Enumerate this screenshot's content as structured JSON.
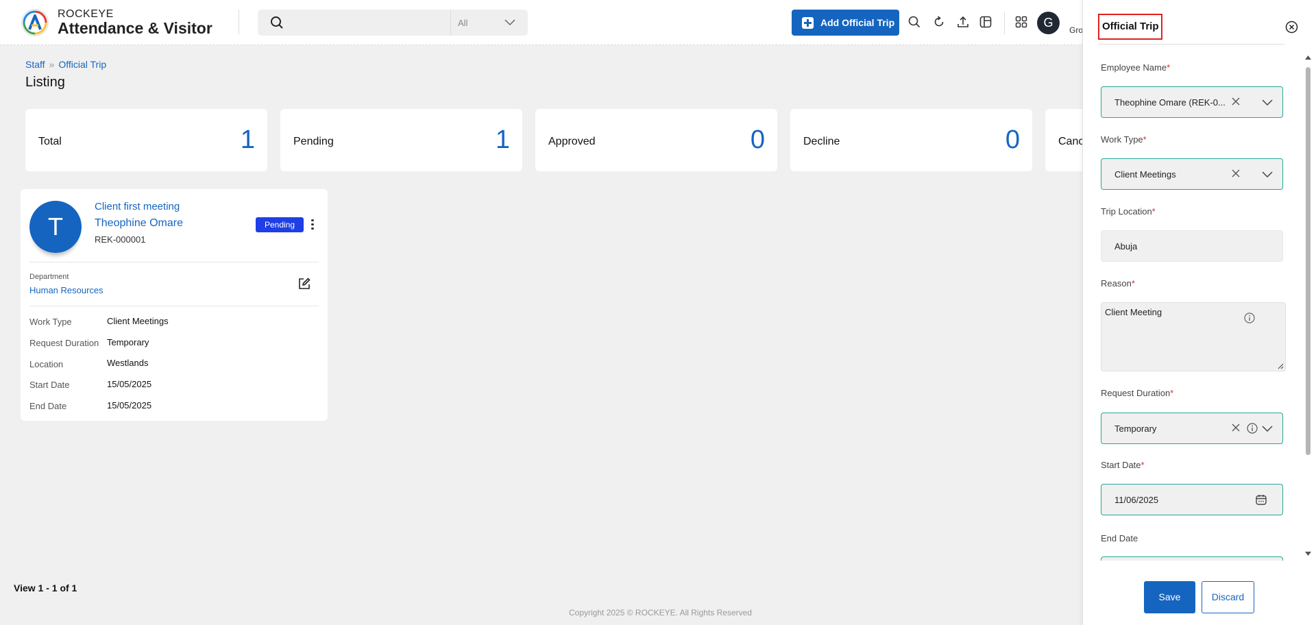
{
  "header": {
    "brand_top": "ROCKEYE",
    "brand_main": "Attendance & Visitor",
    "search": {
      "placeholder": "",
      "scope": "All"
    },
    "add_button": "Add Official Trip",
    "avatar_letter": "G",
    "user_name": "Gro"
  },
  "breadcrumb": {
    "root": "Staff",
    "current": "Official Trip"
  },
  "page_title": "Listing",
  "stats": [
    {
      "label": "Total",
      "value": "1"
    },
    {
      "label": "Pending",
      "value": "1"
    },
    {
      "label": "Approved",
      "value": "0"
    },
    {
      "label": "Decline",
      "value": "0"
    },
    {
      "label": "Canc",
      "value": ""
    }
  ],
  "trip_card": {
    "avatar_letter": "T",
    "title": "Client first meeting",
    "employee_name": "Theophine Omare",
    "employee_code": "REK-000001",
    "status": "Pending",
    "department_label": "Department",
    "department": "Human Resources",
    "details": [
      {
        "label": "Work Type",
        "value": "Client Meetings"
      },
      {
        "label": "Request Duration",
        "value": "Temporary"
      },
      {
        "label": "Location",
        "value": "Westlands"
      },
      {
        "label": "Start Date",
        "value": "15/05/2025"
      },
      {
        "label": "End Date",
        "value": "15/05/2025"
      }
    ]
  },
  "pager": "View 1 - 1 of 1",
  "copyright": "Copyright 2025 © ROCKEYE. All Rights Reserved",
  "panel": {
    "title": "Official Trip",
    "employee_label": "Employee Name",
    "employee_value": "Theophine Omare (REK-0...",
    "work_type_label": "Work Type",
    "work_type_value": "Client Meetings",
    "location_label": "Trip Location",
    "location_value": "Abuja",
    "reason_label": "Reason",
    "reason_value": "Client Meeting",
    "duration_label": "Request Duration",
    "duration_value": "Temporary",
    "start_label": "Start Date",
    "start_value": "11/06/2025",
    "end_label": "End Date",
    "save": "Save",
    "discard": "Discard"
  },
  "colors": {
    "primary": "#1565c0",
    "badge": "#1e3ee6",
    "field_border": "#26a69a",
    "required": "#d32f2f"
  }
}
